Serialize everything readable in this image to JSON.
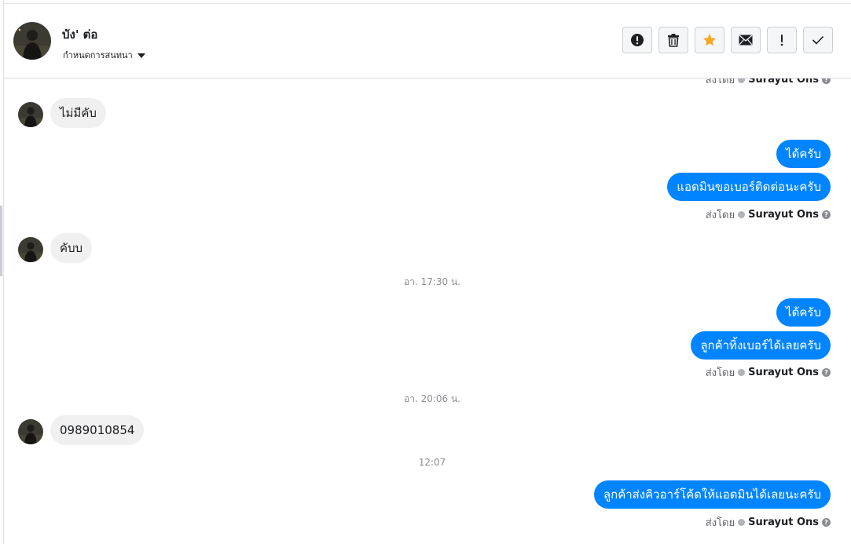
{
  "header": {
    "contact_name": "บัง' ต่อ",
    "assign_label": "กำหนดการสนทนา"
  },
  "toolbar": {
    "buttons": [
      {
        "name": "spam-button",
        "icon": "exclamation-circle-icon"
      },
      {
        "name": "delete-button",
        "icon": "trash-icon"
      },
      {
        "name": "star-button",
        "icon": "star-icon",
        "color": "#f5a623"
      },
      {
        "name": "mark-unread-button",
        "icon": "envelope-icon"
      },
      {
        "name": "follow-up-button",
        "icon": "exclamation-icon"
      },
      {
        "name": "mark-done-button",
        "icon": "checkmark-icon"
      }
    ]
  },
  "colors": {
    "outgoing_bubble": "#0084ff",
    "incoming_bubble": "#f0f0f0",
    "star": "#f5a623"
  },
  "thread": {
    "sent_by_label": "ส่งโดย",
    "agent_name": "Surayut Ons",
    "items": [
      {
        "type": "sent-by",
        "text": "ส่งโดย",
        "agent": "Surayut Ons"
      },
      {
        "type": "incoming",
        "text": "ไม่มีคับ"
      },
      {
        "type": "outgoing",
        "text": "ได้ครับ"
      },
      {
        "type": "outgoing",
        "text": "แอดมินขอเบอร์ติดต่อนะครับ"
      },
      {
        "type": "sent-by",
        "text": "ส่งโดย",
        "agent": "Surayut Ons"
      },
      {
        "type": "incoming",
        "text": "คับบ"
      },
      {
        "type": "timestamp",
        "text": "อา. 17:30 น."
      },
      {
        "type": "outgoing",
        "text": "ได้ครับ"
      },
      {
        "type": "outgoing",
        "text": "ลูกค้าทิ้งเบอร์ได้เลยครับ"
      },
      {
        "type": "sent-by",
        "text": "ส่งโดย",
        "agent": "Surayut Ons"
      },
      {
        "type": "timestamp",
        "text": "อา. 20:06 น."
      },
      {
        "type": "incoming",
        "text": "0989010854"
      },
      {
        "type": "timestamp",
        "text": "12:07"
      },
      {
        "type": "outgoing",
        "text": "ลูกค้าส่งคิวอาร์โค้ดให้แอดมินได้เลยนะครับ"
      },
      {
        "type": "sent-by",
        "text": "ส่งโดย",
        "agent": "Surayut Ons"
      }
    ]
  }
}
